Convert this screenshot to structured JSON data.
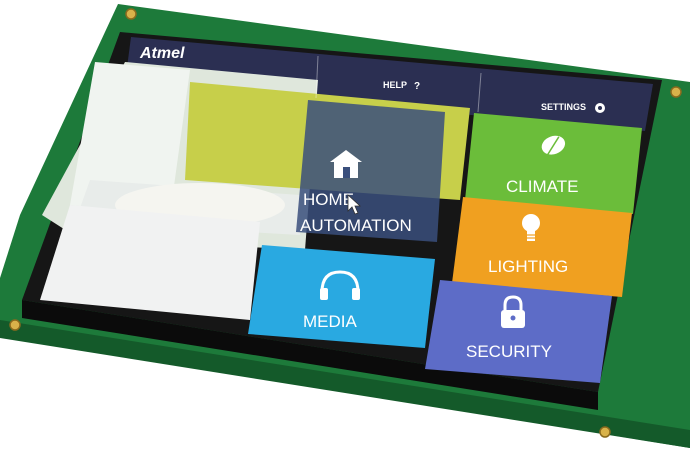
{
  "brand": {
    "logo_text": "Atmel"
  },
  "topbar": {
    "help_label": "HELP",
    "settings_label": "SETTINGS"
  },
  "tiles": {
    "home_automation": {
      "line1": "HOME",
      "line2": "AUTOMATION"
    },
    "climate": {
      "label": "CLIMATE"
    },
    "lighting": {
      "label": "LIGHTING"
    },
    "media": {
      "label": "MEDIA"
    },
    "security": {
      "label": "SECURITY"
    }
  },
  "colors": {
    "pcb": "#1d7a3a",
    "bezel": "#1a1a1a",
    "topbar": "#2b2f52",
    "home": "#3a4f7c",
    "climate": "#6bbd3a",
    "lighting": "#f0a020",
    "media": "#29a9e1",
    "security": "#5d6cc7"
  },
  "icons": {
    "help": "question-icon",
    "settings": "gear-icon",
    "home": "house-icon",
    "climate": "leaf-icon",
    "lighting": "bulb-icon",
    "media": "headphones-icon",
    "security": "padlock-icon"
  }
}
